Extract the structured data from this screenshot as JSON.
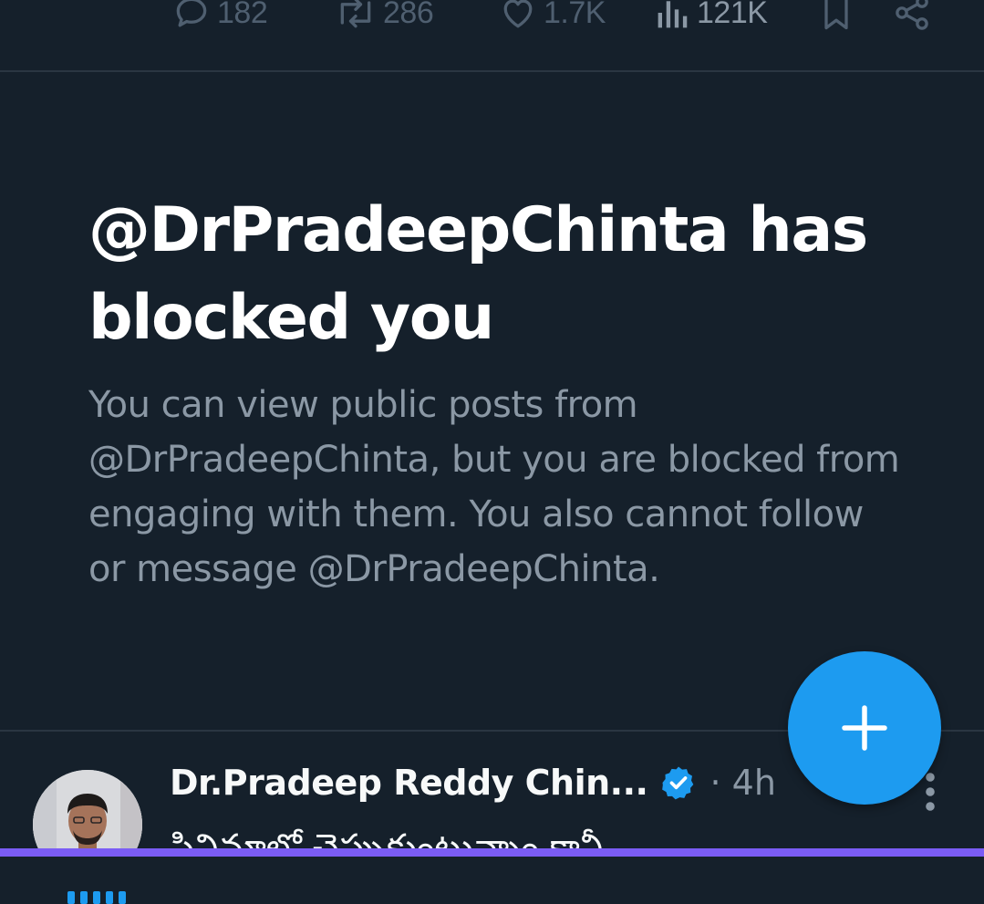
{
  "post_actions": {
    "reply_count": "182",
    "repost_count": "286",
    "like_count": "1.7K",
    "view_count": "121K"
  },
  "block_notice": {
    "title": "@DrPradeepChinta has blocked you",
    "body": "You can view public posts from @DrPradeepChinta, but you are blocked from engaging with them. You also cannot follow or message @DrPradeepChinta."
  },
  "post": {
    "author_name": "Dr.Pradeep Reddy Chin...",
    "time": "· 4h",
    "text": "సినిమాల్లో చెప్పుకుంటున్నాం కానీ"
  },
  "progress": {
    "value_percent": 100
  },
  "icons": {
    "reply": "comment-icon",
    "repost": "repost-icon",
    "like": "heart-icon",
    "views": "views-chart-icon",
    "bookmark": "bookmark-icon",
    "share": "share-icon",
    "verified": "verified-badge-icon",
    "more": "more-vertical-icon",
    "compose": "plus-icon"
  },
  "colors": {
    "background": "#15202b",
    "accent": "#1d9bf0",
    "muted_text": "#8b98a5",
    "progress": "#7b5cf5"
  }
}
